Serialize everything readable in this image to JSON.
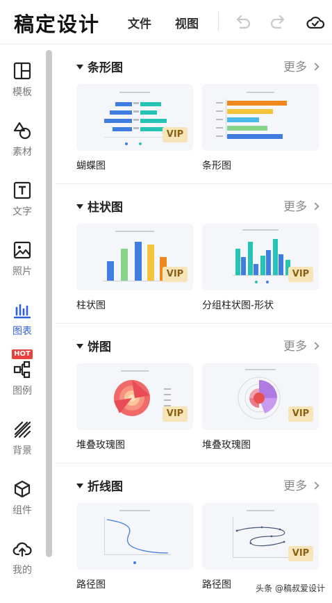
{
  "app": {
    "logo": "稿定设计"
  },
  "header": {
    "menu": [
      {
        "label": "文件"
      },
      {
        "label": "视图"
      }
    ],
    "icons": [
      "undo-icon",
      "redo-icon",
      "cloud-saved-icon"
    ]
  },
  "sidebar": {
    "items": [
      {
        "label": "模板",
        "icon": "template-layout-icon"
      },
      {
        "label": "素材",
        "icon": "shapes-icon"
      },
      {
        "label": "文字",
        "icon": "text-icon"
      },
      {
        "label": "照片",
        "icon": "photo-icon"
      },
      {
        "label": "图表",
        "icon": "bar-chart-icon",
        "active": true
      },
      {
        "label": "图例",
        "icon": "flow-diagram-icon",
        "badge": "HOT"
      },
      {
        "label": "背景",
        "icon": "stripes-background-icon"
      },
      {
        "label": "组件",
        "icon": "cube-icon"
      },
      {
        "label": "我的",
        "icon": "cloud-upload-icon"
      }
    ],
    "active_color": "#2e5fd6"
  },
  "sections": [
    {
      "title": "条形图",
      "more": "更多",
      "cards": [
        {
          "label": "蝴蝶图",
          "badge": "VIP"
        },
        {
          "label": "条形图",
          "badge": ""
        }
      ]
    },
    {
      "title": "柱状图",
      "more": "更多",
      "cards": [
        {
          "label": "柱状图",
          "badge": "VIP"
        },
        {
          "label": "分组柱状图-形状",
          "badge": "VIP"
        }
      ]
    },
    {
      "title": "饼图",
      "more": "更多",
      "cards": [
        {
          "label": "堆叠玫瑰图",
          "badge": "VIP"
        },
        {
          "label": "堆叠玫瑰图",
          "badge": "VIP"
        }
      ]
    },
    {
      "title": "折线图",
      "more": "更多",
      "cards": [
        {
          "label": "路径图",
          "badge": ""
        },
        {
          "label": "路径图",
          "badge": "VIP"
        }
      ]
    }
  ],
  "watermark": "头条 @稿叔爱设计",
  "colors": {
    "vip_bg": "#f8e4b9",
    "vip_text": "#8a6113",
    "hot_badge": "#e8423a",
    "card_bg": "#f4f6f9"
  }
}
